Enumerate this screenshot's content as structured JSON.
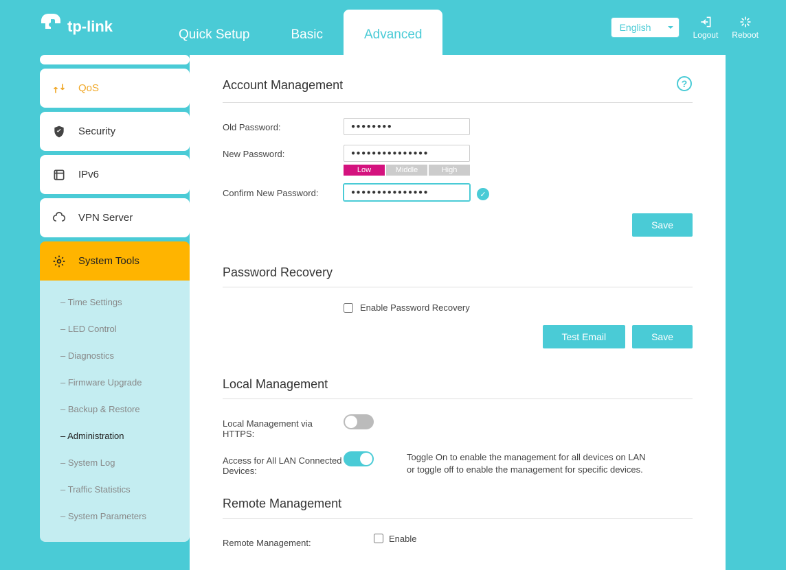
{
  "brand": "tp-link",
  "nav": {
    "quick_setup": "Quick Setup",
    "basic": "Basic",
    "advanced": "Advanced"
  },
  "top": {
    "language": "English",
    "logout": "Logout",
    "reboot": "Reboot"
  },
  "sidebar": {
    "qos": "QoS",
    "security": "Security",
    "ipv6": "IPv6",
    "vpn": "VPN Server",
    "systools": "System Tools",
    "sub": {
      "time": "Time Settings",
      "led": "LED Control",
      "diag": "Diagnostics",
      "fw": "Firmware Upgrade",
      "backup": "Backup & Restore",
      "admin": "Administration",
      "syslog": "System Log",
      "traffic": "Traffic Statistics",
      "sysparam": "System Parameters"
    }
  },
  "account": {
    "title": "Account Management",
    "old_label": "Old Password:",
    "old_value": "●●●●●●●●",
    "new_label": "New Password:",
    "new_value": "●●●●●●●●●●●●●●●",
    "confirm_label": "Confirm New Password:",
    "confirm_value": "●●●●●●●●●●●●●●●",
    "strength": {
      "low": "Low",
      "mid": "Middle",
      "high": "High"
    },
    "save": "Save"
  },
  "recovery": {
    "title": "Password Recovery",
    "enable": "Enable Password Recovery",
    "test": "Test Email",
    "save": "Save"
  },
  "local": {
    "title": "Local Management",
    "https_label": "Local Management via HTTPS:",
    "access_label": "Access for All LAN Connected Devices:",
    "help": "Toggle On to enable the management for all devices on LAN or toggle off to enable the management for specific devices."
  },
  "remote": {
    "title": "Remote Management",
    "label": "Remote Management:",
    "enable": "Enable"
  }
}
